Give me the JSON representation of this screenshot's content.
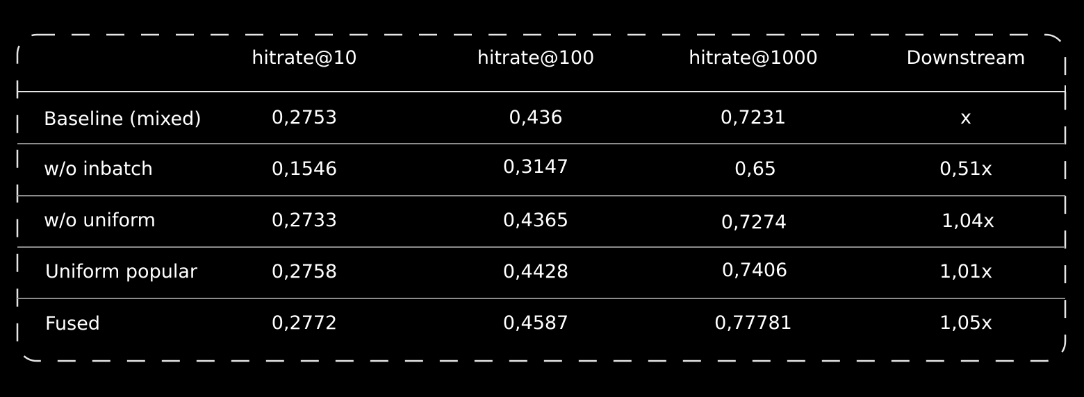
{
  "table": {
    "headers": [
      "",
      "hitrate@10",
      "hitrate@100",
      "hitrate@1000",
      "Downstream"
    ],
    "rows": [
      [
        "Baseline (mixed)",
        "0,2753",
        "0,436",
        "0,7231",
        "x"
      ],
      [
        "w/o inbatch",
        "0,1546",
        "0,3147",
        "0,65",
        "0,51x"
      ],
      [
        "w/o uniform",
        "0,2733",
        "0,4365",
        "0,7274",
        "1,04x"
      ],
      [
        "Uniform popular",
        "0,2758",
        "0,4428",
        "0,7406",
        "1,01x"
      ],
      [
        "Fused",
        "0,2772",
        "0,4587",
        "0,77781",
        "1,05x"
      ]
    ]
  },
  "colors": {
    "background": "#000000",
    "text": "#ffffff",
    "border": "#e6e6e6",
    "divider": "#8c8c8c"
  }
}
